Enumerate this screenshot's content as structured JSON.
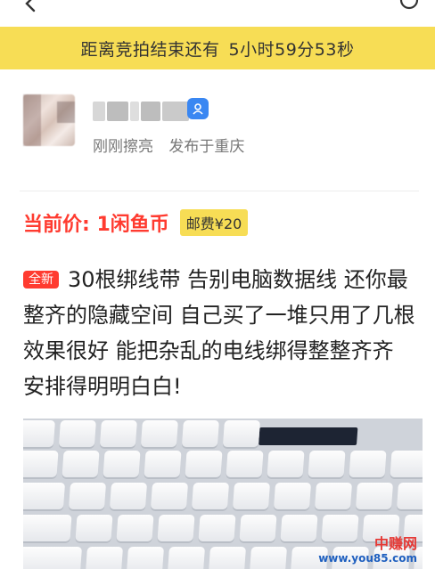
{
  "top": {
    "back_icon": "chevron-left-icon",
    "more_icon": "more-icon"
  },
  "auction": {
    "label": "距离竞拍结束还有",
    "remaining": "5小时59分53秒"
  },
  "seller": {
    "status": "刚刚擦亮",
    "location": "发布于重庆",
    "verified_icon": "verified-badge-icon"
  },
  "price": {
    "label": "当前价: 1闲鱼币",
    "shipping": "邮费¥20"
  },
  "item": {
    "condition_tag": "全新",
    "description": "30根绑线带 告别电脑数据线 还你最整齐的隐藏空间 自己买了一堆只用了几根 效果很好 能把杂乱的电线绑得整整齐齐 安排得明明白白!"
  },
  "watermark": {
    "name": "中赚网",
    "url": "www.you85.com"
  },
  "colors": {
    "accent_yellow": "#f7dd55",
    "price_red": "#ff3b30",
    "verify_blue": "#3a87f2"
  }
}
